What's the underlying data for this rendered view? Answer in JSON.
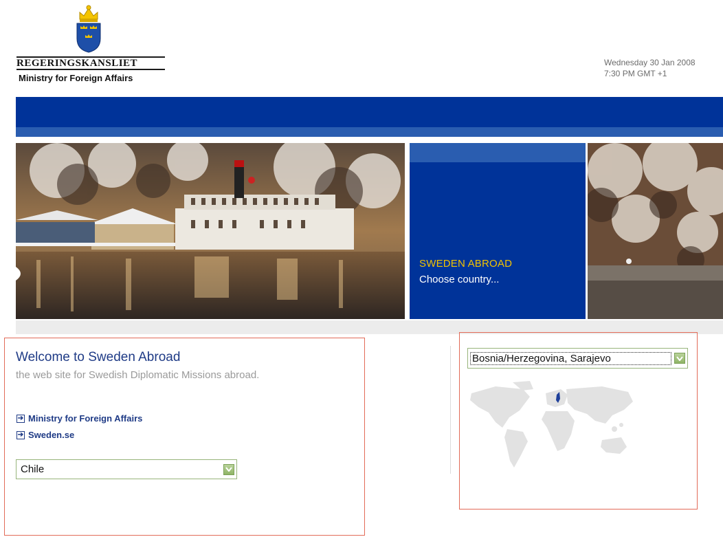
{
  "header": {
    "org_name": "REGERINGSKANSLIET",
    "ministry": "Ministry for Foreign Affairs",
    "date": "Wednesday 30 Jan 2008",
    "time": "7:30 PM GMT +1"
  },
  "banner": {
    "title": "SWEDEN ABROAD",
    "subtitle": "Choose country..."
  },
  "welcome": {
    "title": "Welcome to Sweden Abroad",
    "subtitle": "the web site for Swedish Diplomatic Missions abroad."
  },
  "links": [
    {
      "label": "Ministry for Foreign Affairs"
    },
    {
      "label": "Sweden.se"
    }
  ],
  "country_select": {
    "value": "Chile"
  },
  "mission_select": {
    "value": "Bosnia/Herzegovina, Sarajevo"
  },
  "colors": {
    "brand_blue": "#003399",
    "accent_yellow": "#f4c400",
    "link_blue": "#1f3b86",
    "annotation_red": "#e26a57"
  },
  "icons": [
    "three-crowns-crest-icon",
    "arrow-right-icon",
    "chevron-down-icon",
    "world-map-icon"
  ]
}
